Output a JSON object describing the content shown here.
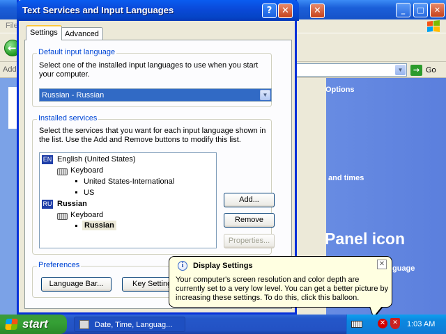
{
  "background_window": {
    "menu_first": "File",
    "address_label": "Address",
    "go_label": "Go",
    "links": [
      "Options",
      "and times"
    ],
    "big_label": "Panel icon",
    "partial_text": "guage"
  },
  "dialog": {
    "title": "Text Services and Input Languages",
    "tabs": [
      "Settings",
      "Advanced"
    ],
    "default_input": {
      "group_title": "Default input language",
      "description": "Select one of the installed input languages to use when you start your computer.",
      "selected": "Russian - Russian"
    },
    "installed_services": {
      "group_title": "Installed services",
      "description": "Select the services that you want for each input language shown in the list. Use the Add and Remove buttons to modify this list.",
      "tree": [
        {
          "badge": "EN",
          "language": "English (United States)",
          "category": "Keyboard",
          "layouts": [
            "United States-International",
            "US"
          ]
        },
        {
          "badge": "RU",
          "language": "Russian",
          "category": "Keyboard",
          "layouts": [
            "Russian"
          ]
        }
      ],
      "buttons": {
        "add": "Add...",
        "remove": "Remove",
        "properties": "Properties..."
      }
    },
    "preferences": {
      "group_title": "Preferences",
      "language_bar": "Language Bar...",
      "key_settings": "Key Settings..."
    }
  },
  "taskbar": {
    "start": "start",
    "task": "Date, Time, Languag...",
    "clock": "1:03 AM"
  },
  "balloon": {
    "title": "Display Settings",
    "text": "Your computer's screen resolution and color depth are currently set to a very low level. You can get a better picture by increasing these settings. To do this, click this balloon."
  }
}
